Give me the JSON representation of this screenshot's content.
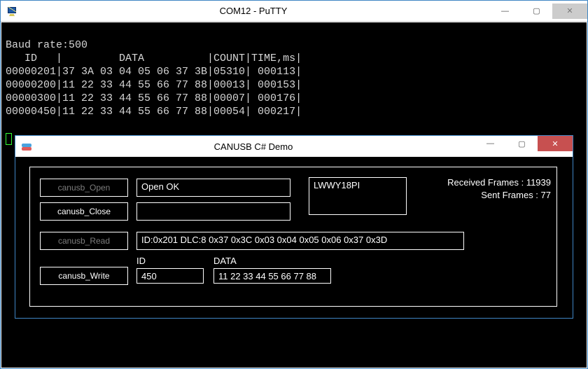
{
  "putty": {
    "title": "COM12 - PuTTY",
    "lines": {
      "l0": "Baud rate:500",
      "l1": "   ID   |         DATA          |COUNT|TIME,ms|",
      "l2": "00000201|37 3A 03 04 05 06 37 3B|05310| 000113|",
      "l3": "00000200|11 22 33 44 55 66 77 88|00013| 000153|",
      "l4": "00000300|11 22 33 44 55 66 77 88|00007| 000176|",
      "l5": "00000450|11 22 33 44 55 66 77 88|00054| 000217|"
    }
  },
  "demo": {
    "title": "CANUSB C# Demo",
    "buttons": {
      "open": "canusb_Open",
      "close": "canusb_Close",
      "read": "canusb_Read",
      "write": "canusb_Write"
    },
    "open_status": "Open OK",
    "serial": "LWWY18PI",
    "close_status": "",
    "read_line": "ID:0x201  DLC:8  0x37 0x3C 0x03 0x04 0x05 0x06 0x37 0x3D",
    "id_label": "ID",
    "data_label": "DATA",
    "write_id": "450",
    "write_data": "11 22 33 44 55 66 77 88",
    "stats": {
      "received": "Received Frames : 11939",
      "sent": "Sent Frames : 77"
    }
  },
  "winctl": {
    "min": "—",
    "max": "▢",
    "close": "✕"
  }
}
